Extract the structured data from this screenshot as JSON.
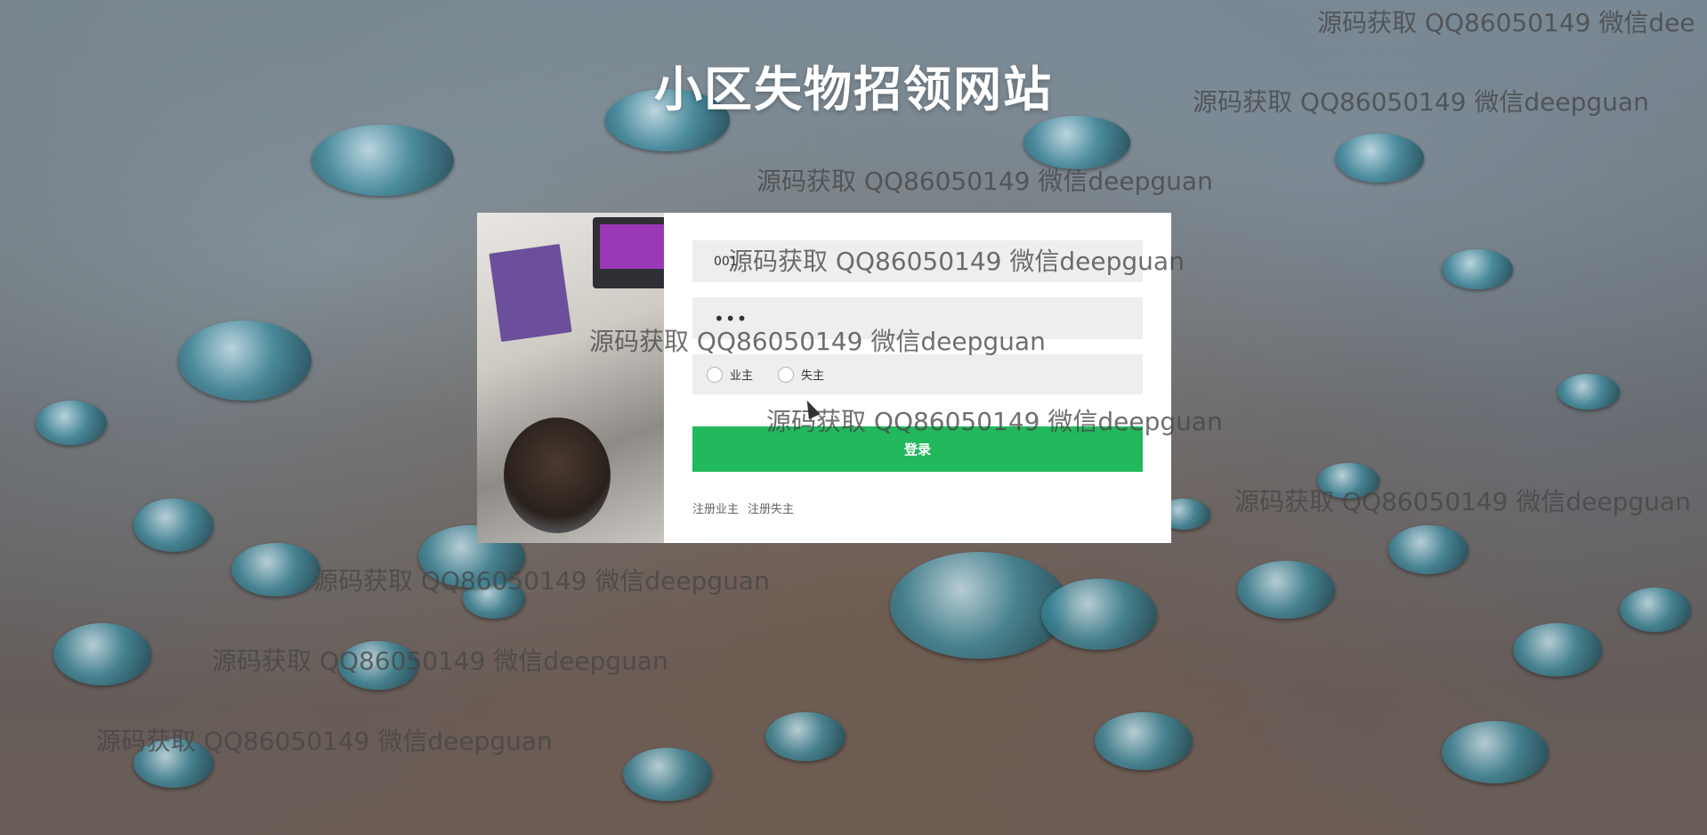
{
  "page": {
    "title": "小区失物招领网站"
  },
  "login": {
    "username_value": "001",
    "password_value": "•••",
    "roles": [
      {
        "label": "业主",
        "selected": false
      },
      {
        "label": "失主",
        "selected": false
      }
    ],
    "submit_label": "登录",
    "links": [
      {
        "label": "注册业主"
      },
      {
        "label": "注册失主"
      }
    ]
  },
  "watermarks": [
    "源码获取 QQ86050149 微信dee",
    "源码获取 QQ86050149 微信deepguan",
    "源码获取 QQ86050149 微信deepguan",
    "源码获取 QQ86050149 微信deepguan",
    "源码获取 QQ86050149 微信deepguan",
    "源码获取 QQ86050149 微信deepguan",
    "源码获取 QQ86050149 微信deepguan",
    "源码获取 QQ86050149 微信deepguan",
    "源码获取 QQ86050149 微信deepguan",
    "源码获取 QQ86050149 微信deepguan"
  ],
  "colors": {
    "accent": "#22b85c",
    "field_bg": "#eeeeee",
    "card_bg": "#ffffff",
    "title": "#ffffff"
  }
}
